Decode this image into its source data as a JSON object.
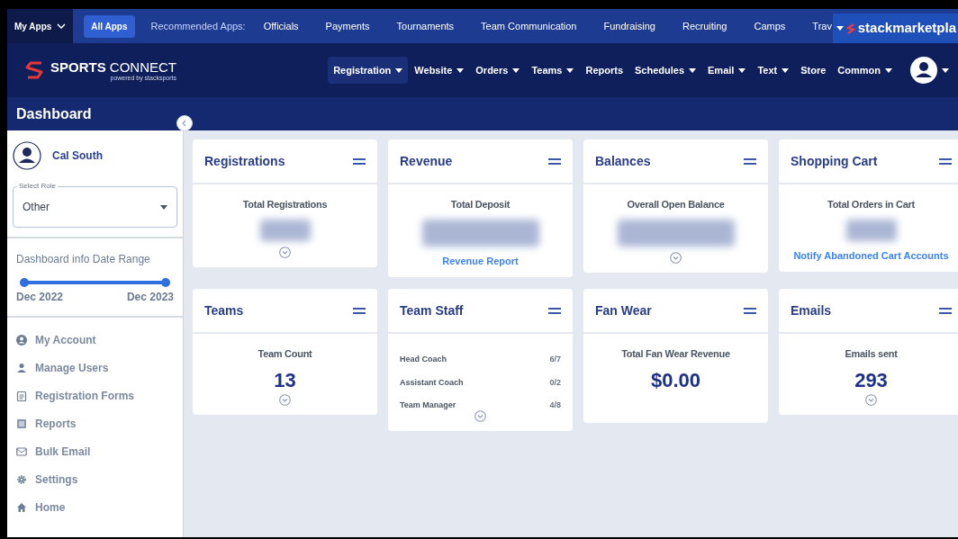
{
  "top_bar": {
    "my_apps": "My Apps",
    "apps": [
      {
        "label": "All Apps",
        "selected": true
      }
    ],
    "recommended_label": "Recommended Apps:",
    "recommended": [
      "Officials",
      "Payments",
      "Tournaments",
      "Team Communication",
      "Fundraising",
      "Recruiting",
      "Camps",
      "Trav"
    ],
    "marketplace_logo": "stackmarketpla"
  },
  "nav": {
    "logo": {
      "bold": "SPORTS",
      "light": "CONNECT",
      "tagline": "powered by stacksports"
    },
    "menu": [
      {
        "label": "Registration",
        "dropdown": true,
        "selected": true
      },
      {
        "label": "Website",
        "dropdown": true,
        "selected": false
      },
      {
        "label": "Orders",
        "dropdown": true,
        "selected": false
      },
      {
        "label": "Teams",
        "dropdown": true,
        "selected": false
      },
      {
        "label": "Reports",
        "dropdown": false,
        "selected": false
      },
      {
        "label": "Schedules",
        "dropdown": true,
        "selected": false
      },
      {
        "label": "Email",
        "dropdown": true,
        "selected": false
      },
      {
        "label": "Text",
        "dropdown": true,
        "selected": false
      },
      {
        "label": "Store",
        "dropdown": false,
        "selected": false
      },
      {
        "label": "Common",
        "dropdown": true,
        "selected": false
      }
    ]
  },
  "page_title": "Dashboard",
  "sidebar": {
    "user": "Cal South",
    "role": {
      "label": "Select Role",
      "value": "Other"
    },
    "date_range": {
      "label": "Dashboard info Date Range",
      "level": 1,
      "start": "Dec 2022",
      "end": "Dec 2023"
    },
    "items": [
      {
        "label": "My Account",
        "kind": "account"
      },
      {
        "label": "Manage Users",
        "kind": "user"
      },
      {
        "label": "Registration Forms",
        "kind": "clipboard"
      },
      {
        "label": "Reports",
        "kind": "list"
      },
      {
        "label": "Bulk Email",
        "kind": "mail"
      },
      {
        "label": "Settings",
        "kind": "gear"
      },
      {
        "label": "Home",
        "kind": "home"
      }
    ]
  },
  "cards": [
    {
      "title": "Registrations",
      "kind": "hidden_count",
      "label": "Total Registrations",
      "expand": true
    },
    {
      "title": "Revenue",
      "kind": "hidden_amount",
      "label": "Total Deposit",
      "expand": false,
      "link": "Revenue Report"
    },
    {
      "title": "Balances",
      "kind": "hidden_amount",
      "label": "Overall Open Balance",
      "expand": true
    },
    {
      "title": "Shopping Cart",
      "kind": "hidden_count",
      "label": "Total Orders in Cart",
      "expand": false,
      "link": "Notify Abandoned Cart Accounts"
    },
    {
      "title": "Teams",
      "kind": "stat",
      "label": "Team Count",
      "value": "13",
      "expand": true
    },
    {
      "title": "Team Staff",
      "kind": "staff",
      "rows": [
        {
          "role": "Head Coach",
          "count": "6/7"
        },
        {
          "role": "Assistant Coach",
          "count": "0/2"
        },
        {
          "role": "Team Manager",
          "count": "4/8"
        }
      ],
      "expand": true
    },
    {
      "title": "Fan Wear",
      "kind": "stat",
      "label": "Total Fan Wear Revenue",
      "value": "$0.00",
      "expand": false
    },
    {
      "title": "Emails",
      "kind": "stat",
      "label": "Emails sent",
      "value": "293",
      "expand": true
    }
  ]
}
